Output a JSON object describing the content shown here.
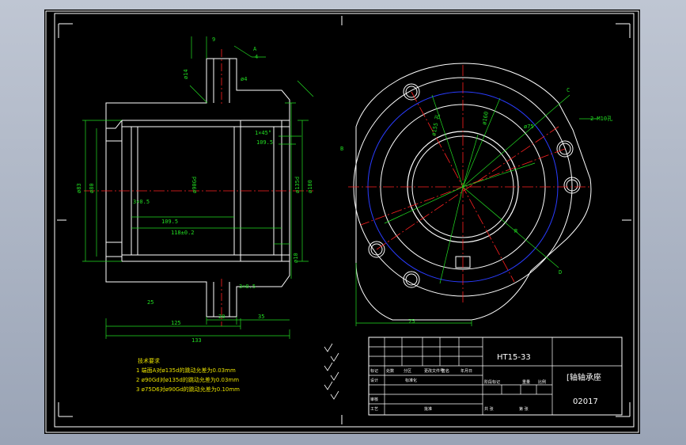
{
  "drawing": {
    "part_code": "HT15-33",
    "part_name": "[轴轴承座",
    "drawing_no": "02017",
    "notes": {
      "title": "技术要求",
      "lines": [
        "1 端面A对ø135d的跳动允差为0.03mm",
        "2 ø90Gd对ø135d的跳动允差为0.03mm",
        "3 ø75D6对ø90Gd的跳动允差为0.10mm"
      ]
    },
    "dims": {
      "d9": "9",
      "d14": "ø14",
      "d4a": "4",
      "d4b": "ø4",
      "c1": "1×45°",
      "c3": "3×0.5",
      "c3b": "3×0.5",
      "l1095": "109.5",
      "l118": "118±0.2",
      "l125": "125",
      "l133": "133",
      "l20": "20",
      "l35": "35",
      "l75": "75",
      "d83": "ø83",
      "d180": "ø180",
      "d135": "ø135d",
      "d155": "ø155 孔",
      "d160": "ø160",
      "dd80": "ø80",
      "dd10": "ø10",
      "d90": "ø90Gd",
      "d75": "ø75",
      "d25": "25",
      "m10": "2-M10孔",
      "labA": "A",
      "labB": "B",
      "labC": "C",
      "labD": "D",
      "labR": "R"
    }
  },
  "title_block": {
    "cells": [
      "标记",
      "处数",
      "分区",
      "更改文件号",
      "签名",
      "年月日",
      "设计",
      "标准化",
      "审核",
      "工艺",
      "批准",
      "阶段标记",
      "重量",
      "比例",
      "共 张",
      "第 张"
    ]
  }
}
